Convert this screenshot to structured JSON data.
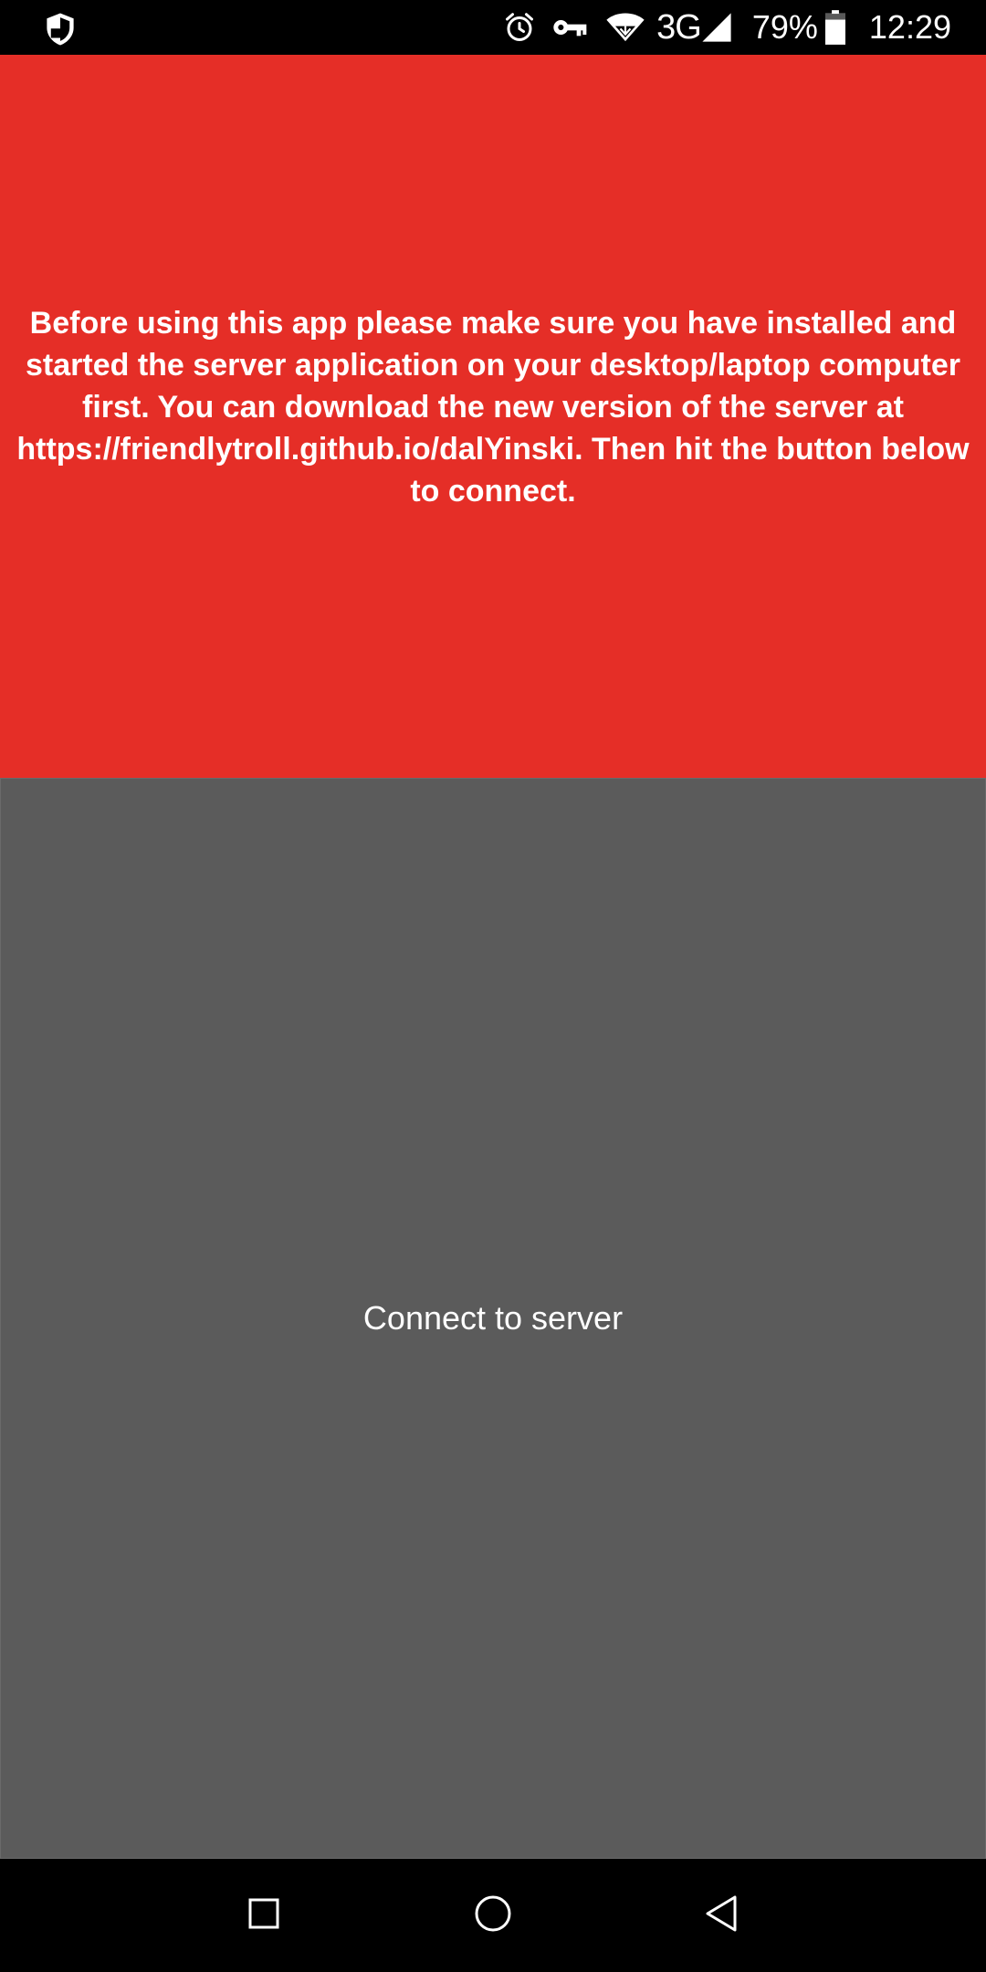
{
  "status_bar": {
    "icons": [
      "shield-icon",
      "alarm-icon",
      "vpn-key-icon",
      "wifi-icon",
      "cell-signal-icon",
      "battery-icon"
    ],
    "network_type": "3G",
    "battery_percent": "79%",
    "time": "12:29",
    "battery_level": 0.79
  },
  "info": {
    "message": "Before using this app please make sure you have installed and started the server application on your desktop/laptop computer first. You can download the new version of the server at https://friendlytroll.github.io/dalYinski. Then hit the button below to connect."
  },
  "connect": {
    "label": "Connect to server"
  },
  "nav_bar": {
    "buttons": [
      "recents-icon",
      "home-icon",
      "back-icon"
    ]
  },
  "colors": {
    "info_background": "#e52e27",
    "button_background": "#5b5b5b",
    "bars_background": "#000000",
    "text": "#ffffff"
  }
}
